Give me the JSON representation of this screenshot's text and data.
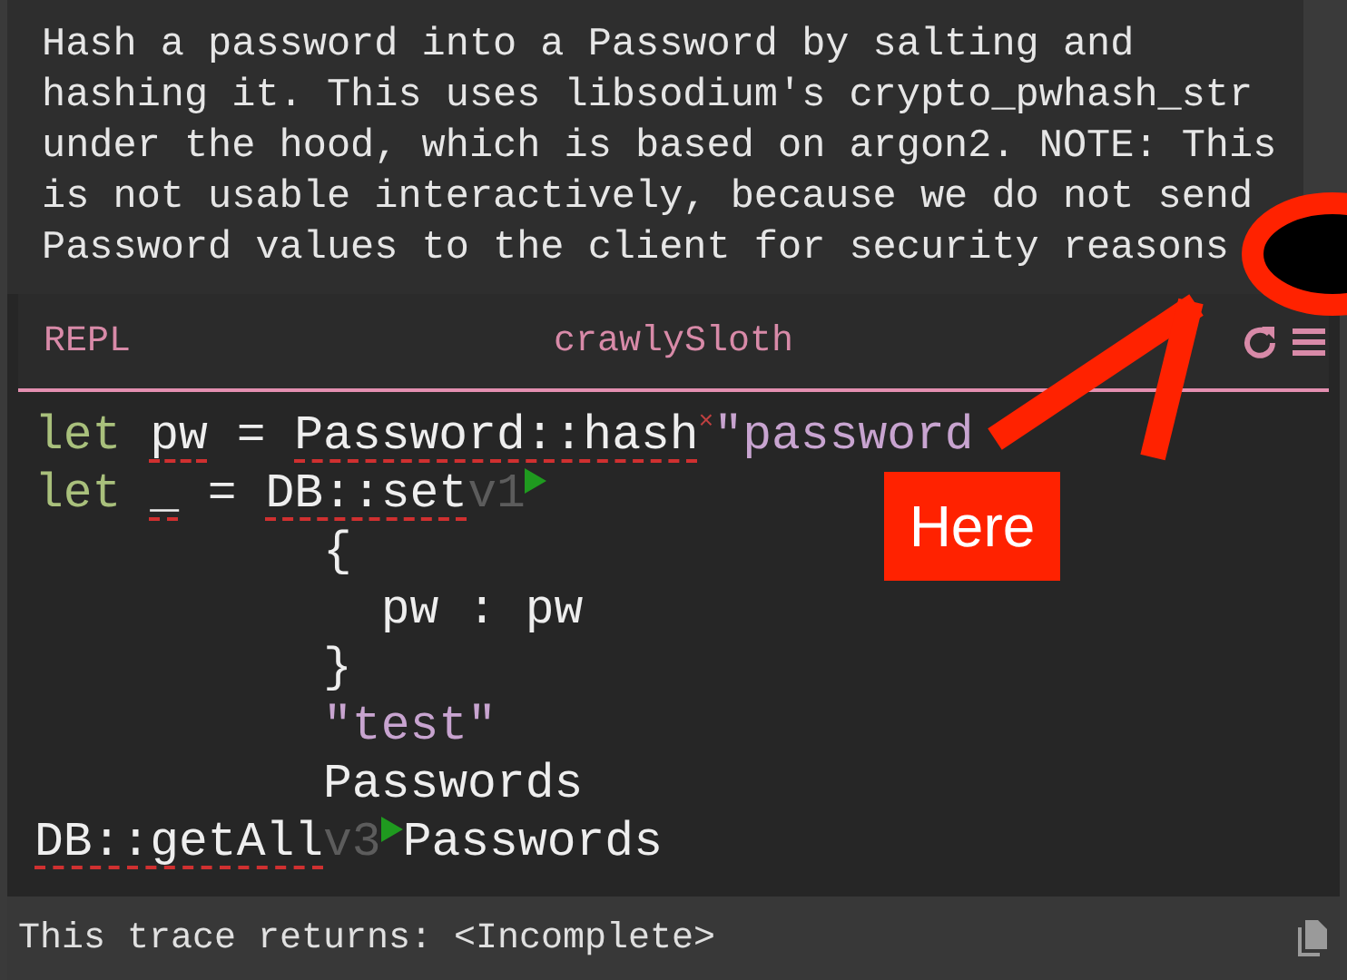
{
  "description": "Hash a password into a Password by salting and hashing it. This uses libsodium's crypto_pwhash_str under the hood, which is based on argon2. NOTE: This is not usable interactively, because we do not send Password values to the client for security reasons",
  "header": {
    "label": "REPL",
    "title": "crawlySloth"
  },
  "code": {
    "lines": [
      {
        "tokens": [
          {
            "kind": "keyword",
            "text": "let "
          },
          {
            "kind": "plain",
            "text": "pw",
            "error": true
          },
          {
            "kind": "plain",
            "text": " = "
          },
          {
            "kind": "plain",
            "text": "Password::hash",
            "error": true
          },
          {
            "kind": "error_mark",
            "text": "×"
          },
          {
            "kind": "string",
            "text": "\"password"
          }
        ]
      },
      {
        "tokens": [
          {
            "kind": "keyword",
            "text": "let "
          },
          {
            "kind": "plain",
            "text": "_",
            "error": true
          },
          {
            "kind": "plain",
            "text": " = "
          },
          {
            "kind": "plain",
            "text": "DB::set",
            "error": true
          },
          {
            "kind": "version",
            "text": "v1"
          },
          {
            "kind": "run"
          }
        ]
      },
      {
        "tokens": [
          {
            "kind": "plain",
            "text": "          {"
          }
        ]
      },
      {
        "tokens": [
          {
            "kind": "plain",
            "text": "            pw : pw"
          }
        ]
      },
      {
        "tokens": [
          {
            "kind": "plain",
            "text": "          }"
          }
        ]
      },
      {
        "tokens": [
          {
            "kind": "string",
            "text": "          \"test\""
          }
        ]
      },
      {
        "tokens": [
          {
            "kind": "plain",
            "text": "          Passwords"
          }
        ]
      },
      {
        "tokens": [
          {
            "kind": "plain",
            "text": "DB::getAll",
            "error": true
          },
          {
            "kind": "version",
            "text": "v3"
          },
          {
            "kind": "run"
          },
          {
            "kind": "plain",
            "text": "Passwords"
          }
        ]
      }
    ]
  },
  "footer": {
    "text": "This trace returns: <Incomplete>"
  },
  "annotation": {
    "label": "Here"
  }
}
